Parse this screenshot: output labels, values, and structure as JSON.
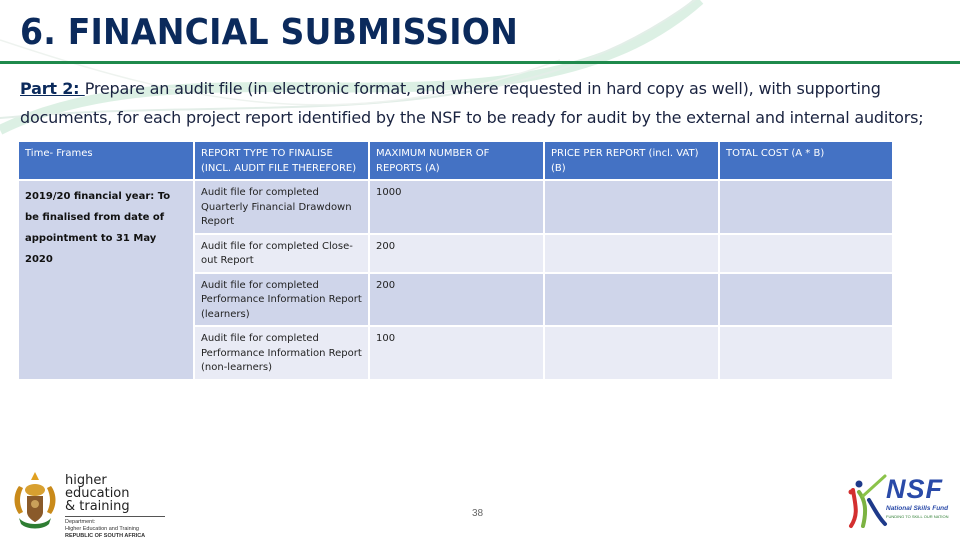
{
  "slide": {
    "title": "6. FINANCIAL SUBMISSION",
    "intro_label": "Part 2: ",
    "intro_text": "Prepare an audit file (in electronic format, and where requested in hard copy as well), with supporting documents, for each project report identified by the NSF to be ready for audit by the external and internal auditors;",
    "page_number": "38"
  },
  "table": {
    "headers": [
      "Time- Frames",
      "REPORT TYPE TO FINALISE (INCL. AUDIT FILE THEREFORE)",
      "MAXIMUM NUMBER OF REPORTS (A)",
      "PRICE PER REPORT (incl. VAT) (B)",
      "TOTAL COST (A * B)"
    ],
    "time_frame": "2019/20 financial year: To be finalised from date of appointment to 31 May 2020",
    "rows": [
      {
        "report_type": "Audit file for completed Quarterly Financial Drawdown Report",
        "max_reports": "1000",
        "price": "",
        "total": ""
      },
      {
        "report_type": "Audit file for completed Close-out Report",
        "max_reports": "200",
        "price": "",
        "total": ""
      },
      {
        "report_type": "Audit file for completed Performance Information Report (learners)",
        "max_reports": "200",
        "price": "",
        "total": ""
      },
      {
        "report_type": "Audit file for completed Performance Information Report (non-learners)",
        "max_reports": "100",
        "price": "",
        "total": ""
      }
    ]
  },
  "logos": {
    "left": {
      "line1": "higher education",
      "line2": "& training",
      "dept1": "Department:",
      "dept2": "Higher Education and Training",
      "dept3": "REPUBLIC OF SOUTH AFRICA"
    },
    "right": {
      "name": "NSF",
      "sub": "National Skills Fund",
      "tagline": "FUNDING TO SKILL OUR NATION"
    }
  },
  "colors": {
    "title": "#0b2a5c",
    "rule": "#1f8a4c",
    "header_fill": "#4472c4",
    "row_dark": "#cfd5ea",
    "row_light": "#e9ebf5"
  }
}
